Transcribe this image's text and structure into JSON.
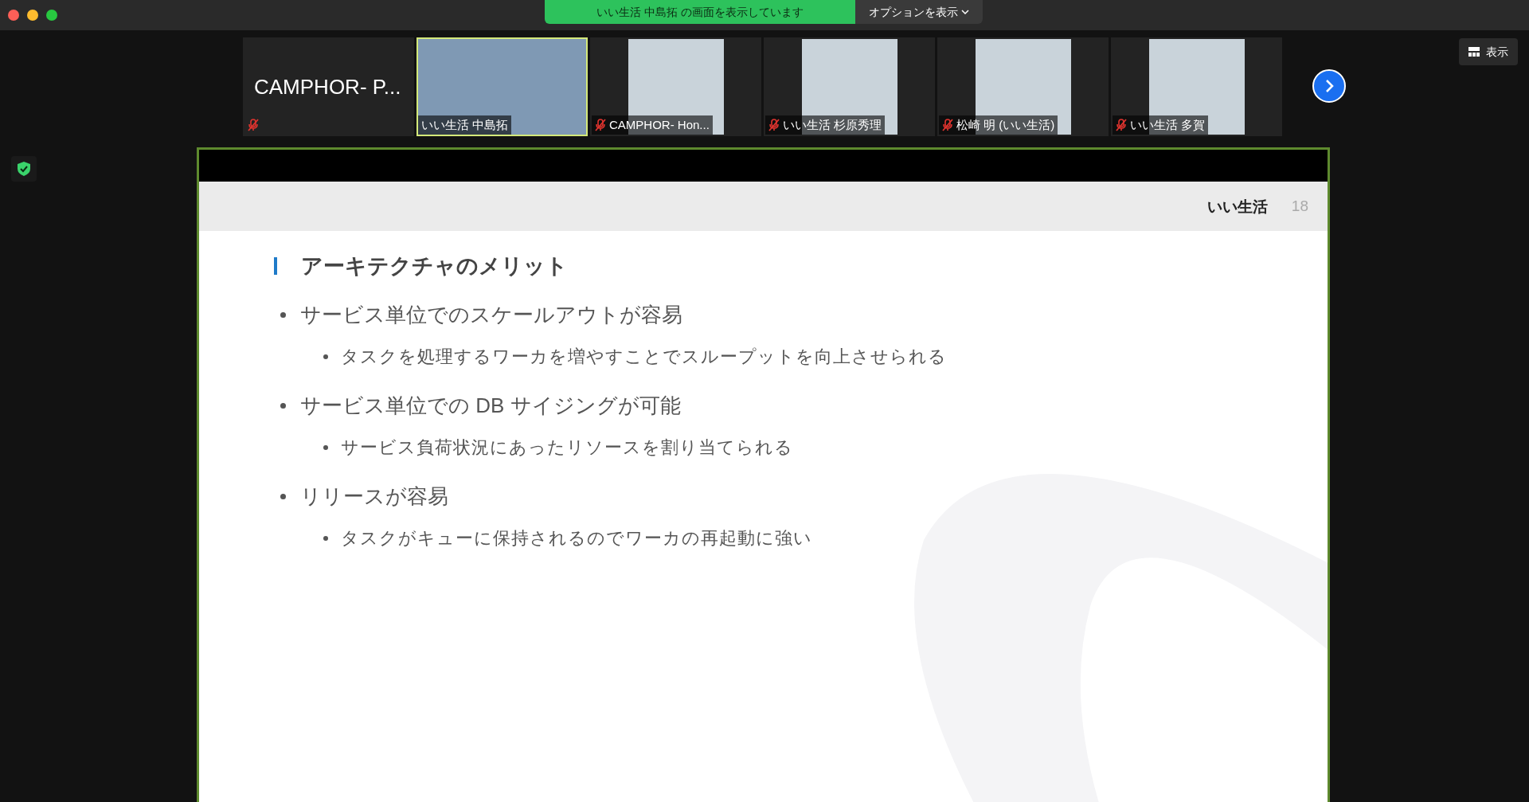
{
  "top_bar": {
    "sharing_notice": "いい生活 中島拓 の画面を表示しています",
    "options_button": "オプションを表示"
  },
  "view_button": "表示",
  "participants": [
    {
      "kind": "name_only",
      "name": "CAMPHOR- P...",
      "muted": true,
      "speaking": false
    },
    {
      "kind": "video",
      "name": "いい生活 中島拓",
      "muted": false,
      "speaking": true
    },
    {
      "kind": "picture",
      "name": "CAMPHOR- Hon...",
      "muted": true,
      "speaking": false
    },
    {
      "kind": "picture",
      "name": "いい生活 杉原秀理",
      "muted": true,
      "speaking": false
    },
    {
      "kind": "picture",
      "name": "松崎 明 (いい生活)",
      "muted": true,
      "speaking": false
    },
    {
      "kind": "picture",
      "name": "いい生活 多賀",
      "muted": true,
      "speaking": false
    }
  ],
  "slide": {
    "brand": "いい生活",
    "page_number": "18",
    "title": "アーキテクチャのメリット",
    "bullets": [
      {
        "text": "サービス単位でのスケールアウトが容易",
        "children": [
          {
            "text": "タスクを処理するワーカを増やすことでスループットを向上させられる"
          }
        ]
      },
      {
        "text": "サービス単位での DB サイジングが可能",
        "children": [
          {
            "text": "サービス負荷状況にあったリソースを割り当てられる"
          }
        ]
      },
      {
        "text": "リリースが容易",
        "children": [
          {
            "text": "タスクがキューに保持されるのでワーカの再起動に強い"
          }
        ]
      }
    ]
  }
}
